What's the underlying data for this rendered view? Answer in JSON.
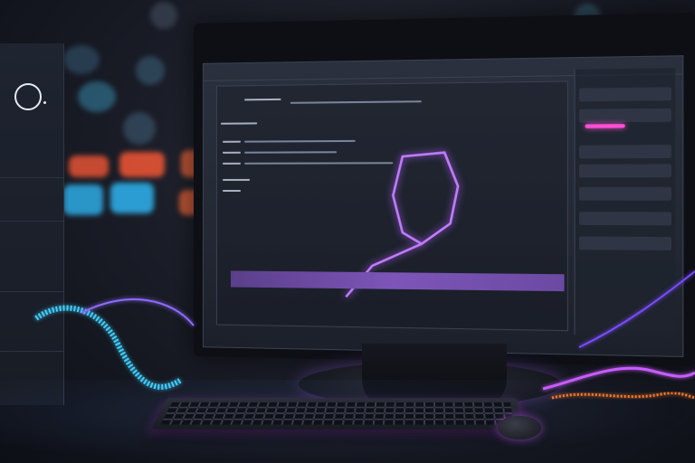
{
  "scene": {
    "description_free": true,
    "accent_colors": {
      "purple": "#a86bff",
      "pink": "#ff4fd8",
      "cyan": "#39c6ff",
      "orange": "#ff7a2a"
    }
  },
  "icons": {
    "left_ring": "circle-ring-icon",
    "monitor_shape": "hexagon-outline-icon",
    "keyboard": "keyboard-icon",
    "mouse": "mouse-icon"
  }
}
